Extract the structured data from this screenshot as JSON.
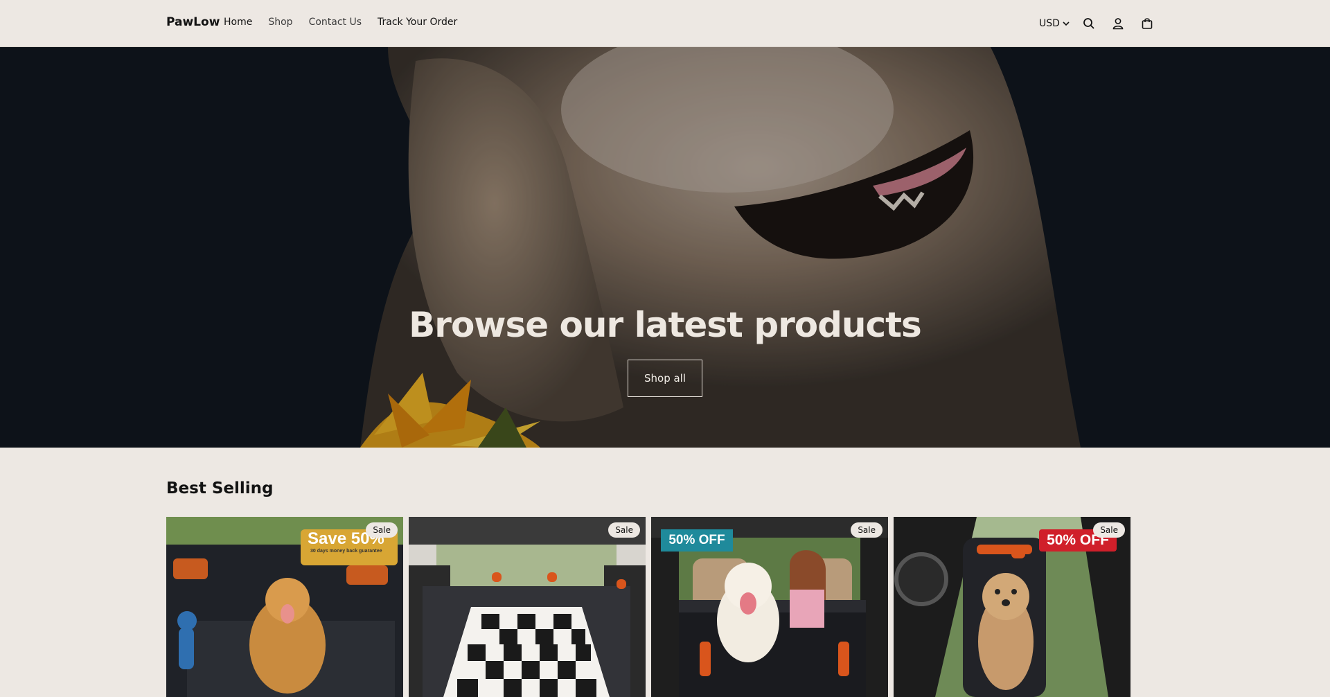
{
  "header": {
    "logo": "PawLow",
    "nav": [
      {
        "label": "Home"
      },
      {
        "label": "Shop"
      },
      {
        "label": "Contact Us"
      },
      {
        "label": "Track Your Order"
      }
    ],
    "currency": "USD"
  },
  "hero": {
    "title": "Browse our latest products",
    "button": "Shop all"
  },
  "best_selling": {
    "title": "Best Selling",
    "products": [
      {
        "badge": "Sale",
        "promo": "Save 50%",
        "promo_sub": "30 days money back guarantee"
      },
      {
        "badge": "Sale"
      },
      {
        "badge": "Sale",
        "promo": "50% OFF"
      },
      {
        "badge": "Sale",
        "promo": "50% OFF"
      }
    ]
  }
}
